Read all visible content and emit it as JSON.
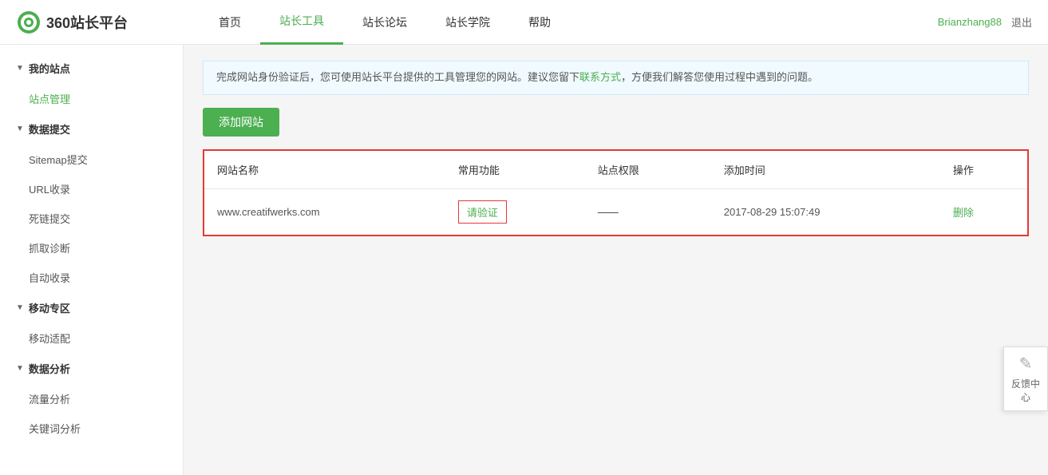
{
  "header": {
    "logo_text": "360站长平台",
    "nav_items": [
      {
        "label": "首页",
        "active": false
      },
      {
        "label": "站长工具",
        "active": true
      },
      {
        "label": "站长论坛",
        "active": false
      },
      {
        "label": "站长学院",
        "active": false
      },
      {
        "label": "帮助",
        "active": false
      }
    ],
    "username": "Brianzhang88",
    "logout": "退出"
  },
  "sidebar": {
    "groups": [
      {
        "title": "我的站点",
        "items": [
          {
            "label": "站点管理",
            "active": true
          }
        ]
      },
      {
        "title": "数据提交",
        "items": [
          {
            "label": "Sitemap提交",
            "active": false
          },
          {
            "label": "URL收录",
            "active": false
          },
          {
            "label": "死链提交",
            "active": false
          },
          {
            "label": "抓取诊断",
            "active": false
          },
          {
            "label": "自动收录",
            "active": false
          }
        ]
      },
      {
        "title": "移动专区",
        "items": [
          {
            "label": "移动适配",
            "active": false
          }
        ]
      },
      {
        "title": "数据分析",
        "items": [
          {
            "label": "流量分析",
            "active": false
          },
          {
            "label": "关键词分析",
            "active": false
          }
        ]
      }
    ]
  },
  "content": {
    "notice": "完成网站身份验证后，您可使用站长平台提供的工具管理您的网站。建议您留下",
    "notice_link": "联系方式",
    "notice_suffix": "，方便我们解答您使用过程中遇到的问题。",
    "add_button": "添加网站",
    "table": {
      "headers": [
        "网站名称",
        "常用功能",
        "站点权限",
        "添加时间",
        "操作"
      ],
      "rows": [
        {
          "name": "www.creatifwerks.com",
          "function_label": "请验证",
          "permission": "——",
          "time": "2017-08-29 15:07:49",
          "action": "删除"
        }
      ]
    }
  },
  "feedback": {
    "label": "反馈中心",
    "icon": "✎"
  }
}
